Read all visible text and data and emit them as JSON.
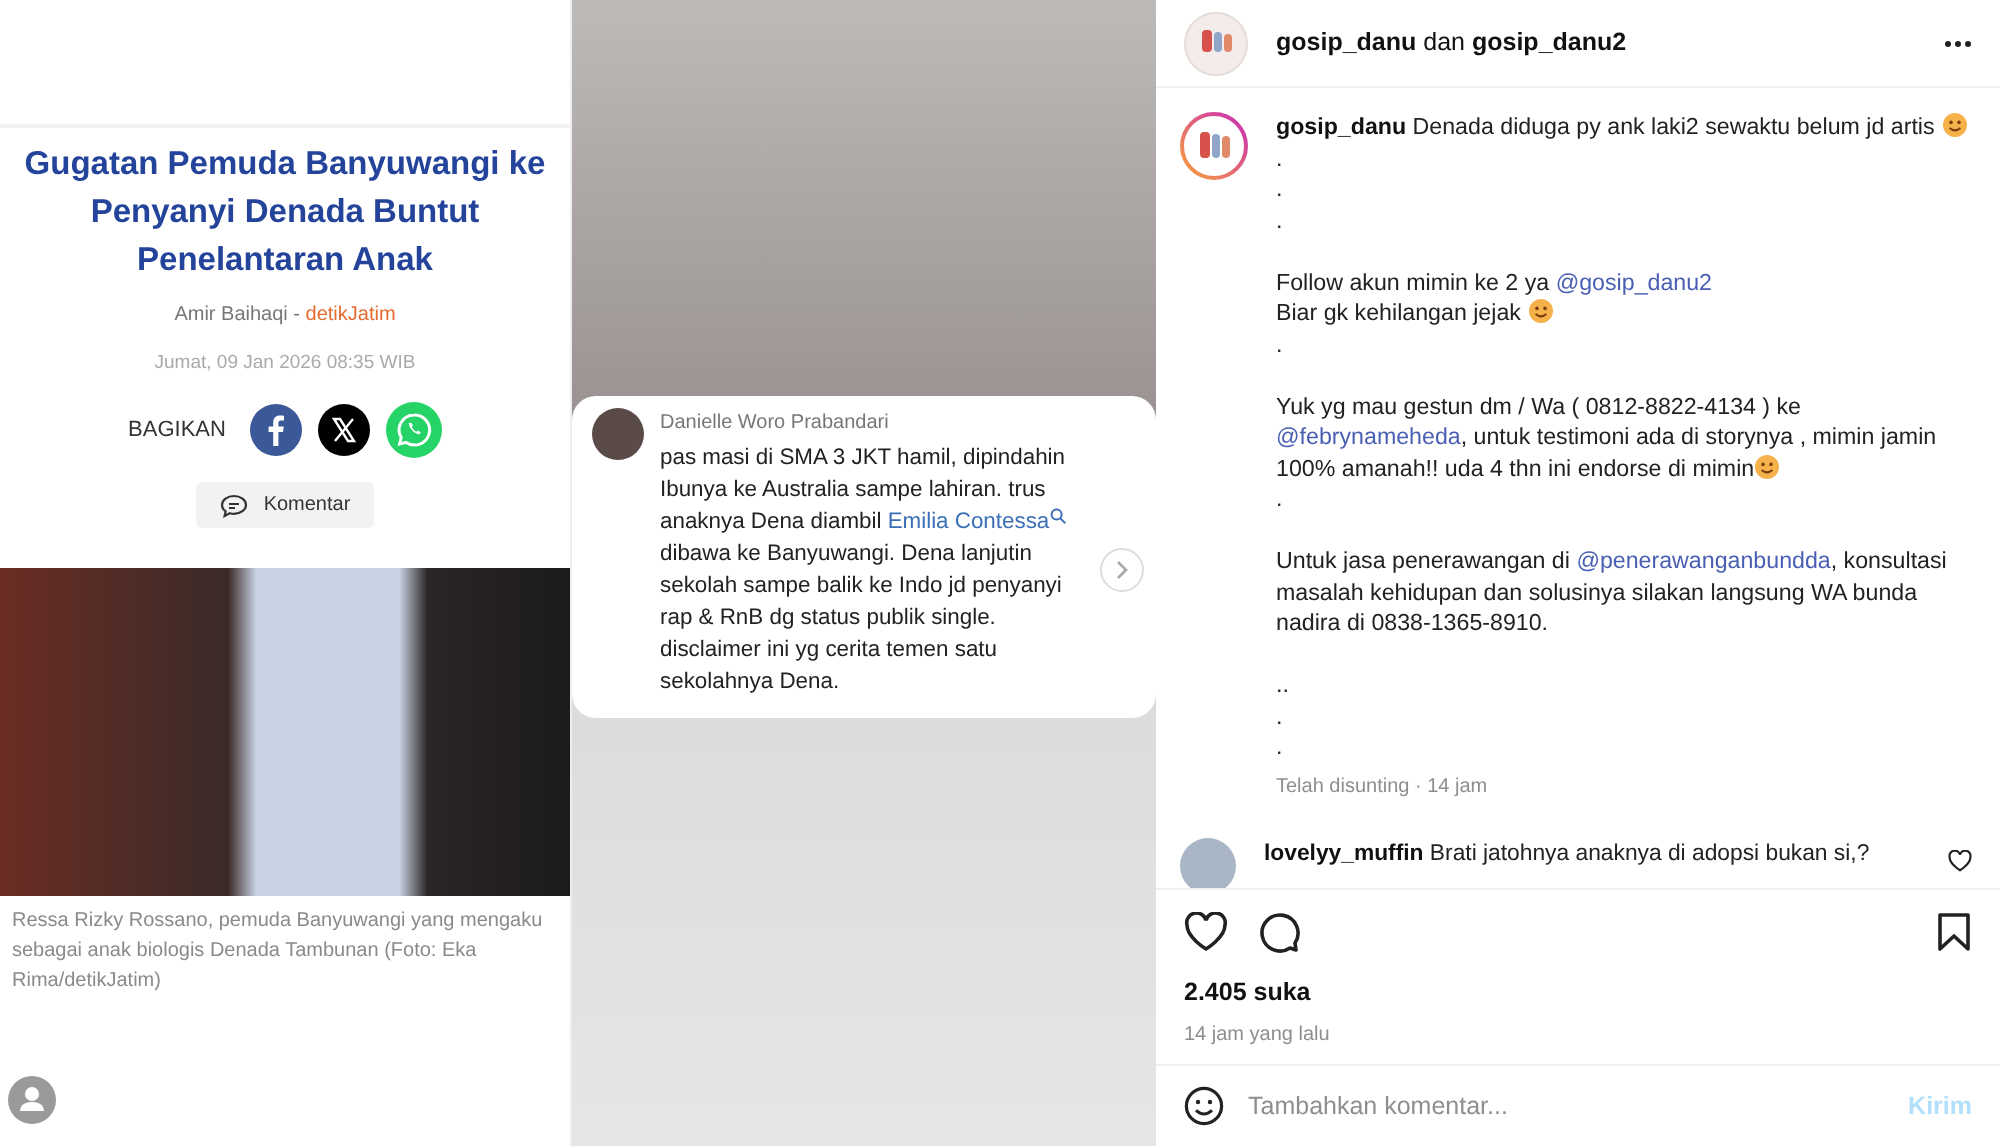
{
  "article": {
    "title": "Gugatan Pemuda Banyuwangi ke Penyanyi Denada Buntut Penelantaran Anak",
    "author": "Amir Baihaqi -",
    "source": "detikJatim",
    "date": "Jumat, 09 Jan 2026 08:35 WIB",
    "share_label": "BAGIKAN",
    "share": [
      {
        "kind": "facebook"
      },
      {
        "kind": "x"
      },
      {
        "kind": "whatsapp"
      }
    ],
    "comment_button": "Komentar",
    "photo_caption": "Ressa Rizky Rossano, pemuda Banyuwangi yang mengaku sebagai anak biologis Denada Tambunan (Foto: Eka Rima/detikJatim)"
  },
  "screenshot_comment": {
    "name": "Danielle Woro Prabandari",
    "parts": [
      {
        "kind": "text",
        "text": "pas masi di SMA 3 JKT hamil, dipindahin Ibunya ke Australia sampe lahiran. trus anaknya Dena diambil "
      },
      {
        "kind": "link",
        "text": "Emilia Contessa"
      },
      {
        "kind": "search"
      },
      {
        "kind": "text",
        "text": " dibawa ke Banyuwangi. Dena lanjutin sekolah sampe balik ke Indo jd penyanyi rap & RnB dg status publik single. disclaimer ini yg cerita temen satu sekolahnya Dena."
      }
    ]
  },
  "post": {
    "header": [
      {
        "kind": "user",
        "text": "gosip_danu"
      },
      {
        "kind": "text",
        "text": "dan"
      },
      {
        "kind": "user",
        "text": "gosip_danu2"
      }
    ],
    "caption": [
      [
        [
          {
            "kind": "user",
            "text": "gosip_danu"
          },
          {
            "kind": "text",
            "text": " Denada diduga py ank laki2 sewaktu belum jd artis "
          },
          {
            "kind": "emoji"
          },
          {
            "kind": "text",
            "text": " ."
          }
        ],
        [
          {
            "kind": "text",
            "text": "."
          }
        ],
        [
          {
            "kind": "text",
            "text": "."
          }
        ]
      ],
      [
        [
          {
            "kind": "text",
            "text": "Follow akun mimin ke 2 ya "
          },
          {
            "kind": "mention",
            "text": "@gosip_danu2"
          }
        ],
        [
          {
            "kind": "text",
            "text": "Biar gk kehilangan jejak "
          },
          {
            "kind": "emoji"
          }
        ],
        [
          {
            "kind": "text",
            "text": "."
          }
        ]
      ],
      [
        [
          {
            "kind": "text",
            "text": "Yuk yg mau gestun dm / Wa ( 0812-8822-4134 ) ke "
          },
          {
            "kind": "mention",
            "text": "@febrynameheda"
          },
          {
            "kind": "text",
            "text": ", untuk testimoni ada di storynya , mimin jamin 100% amanah!! uda 4 thn ini endorse di mimin"
          },
          {
            "kind": "emoji"
          }
        ],
        [
          {
            "kind": "text",
            "text": "."
          }
        ]
      ],
      [
        [
          {
            "kind": "text",
            "text": "Untuk jasa penerawangan di "
          },
          {
            "kind": "mention",
            "text": "@penerawanganbundda"
          },
          {
            "kind": "text",
            "text": ", konsultasi masalah kehidupan dan solusinya silakan langsung WA bunda nadira di 0838-1365-8910."
          }
        ]
      ],
      [
        [
          {
            "kind": "text",
            "text": ".."
          }
        ],
        [
          {
            "kind": "text",
            "text": "."
          }
        ],
        [
          {
            "kind": "text",
            "text": "."
          }
        ]
      ]
    ],
    "edited": "Telah disunting · 14 jam",
    "comments": [
      {
        "user": "lovelyy_muffin",
        "text": "Brati jatohnya anaknya di adopsi bukan si,?"
      }
    ],
    "likes": "2.405 suka",
    "time": "14 jam yang lalu",
    "comment_input": {
      "placeholder": "Tambahkan komentar...",
      "button": "Kirim",
      "disabled": true
    }
  }
}
